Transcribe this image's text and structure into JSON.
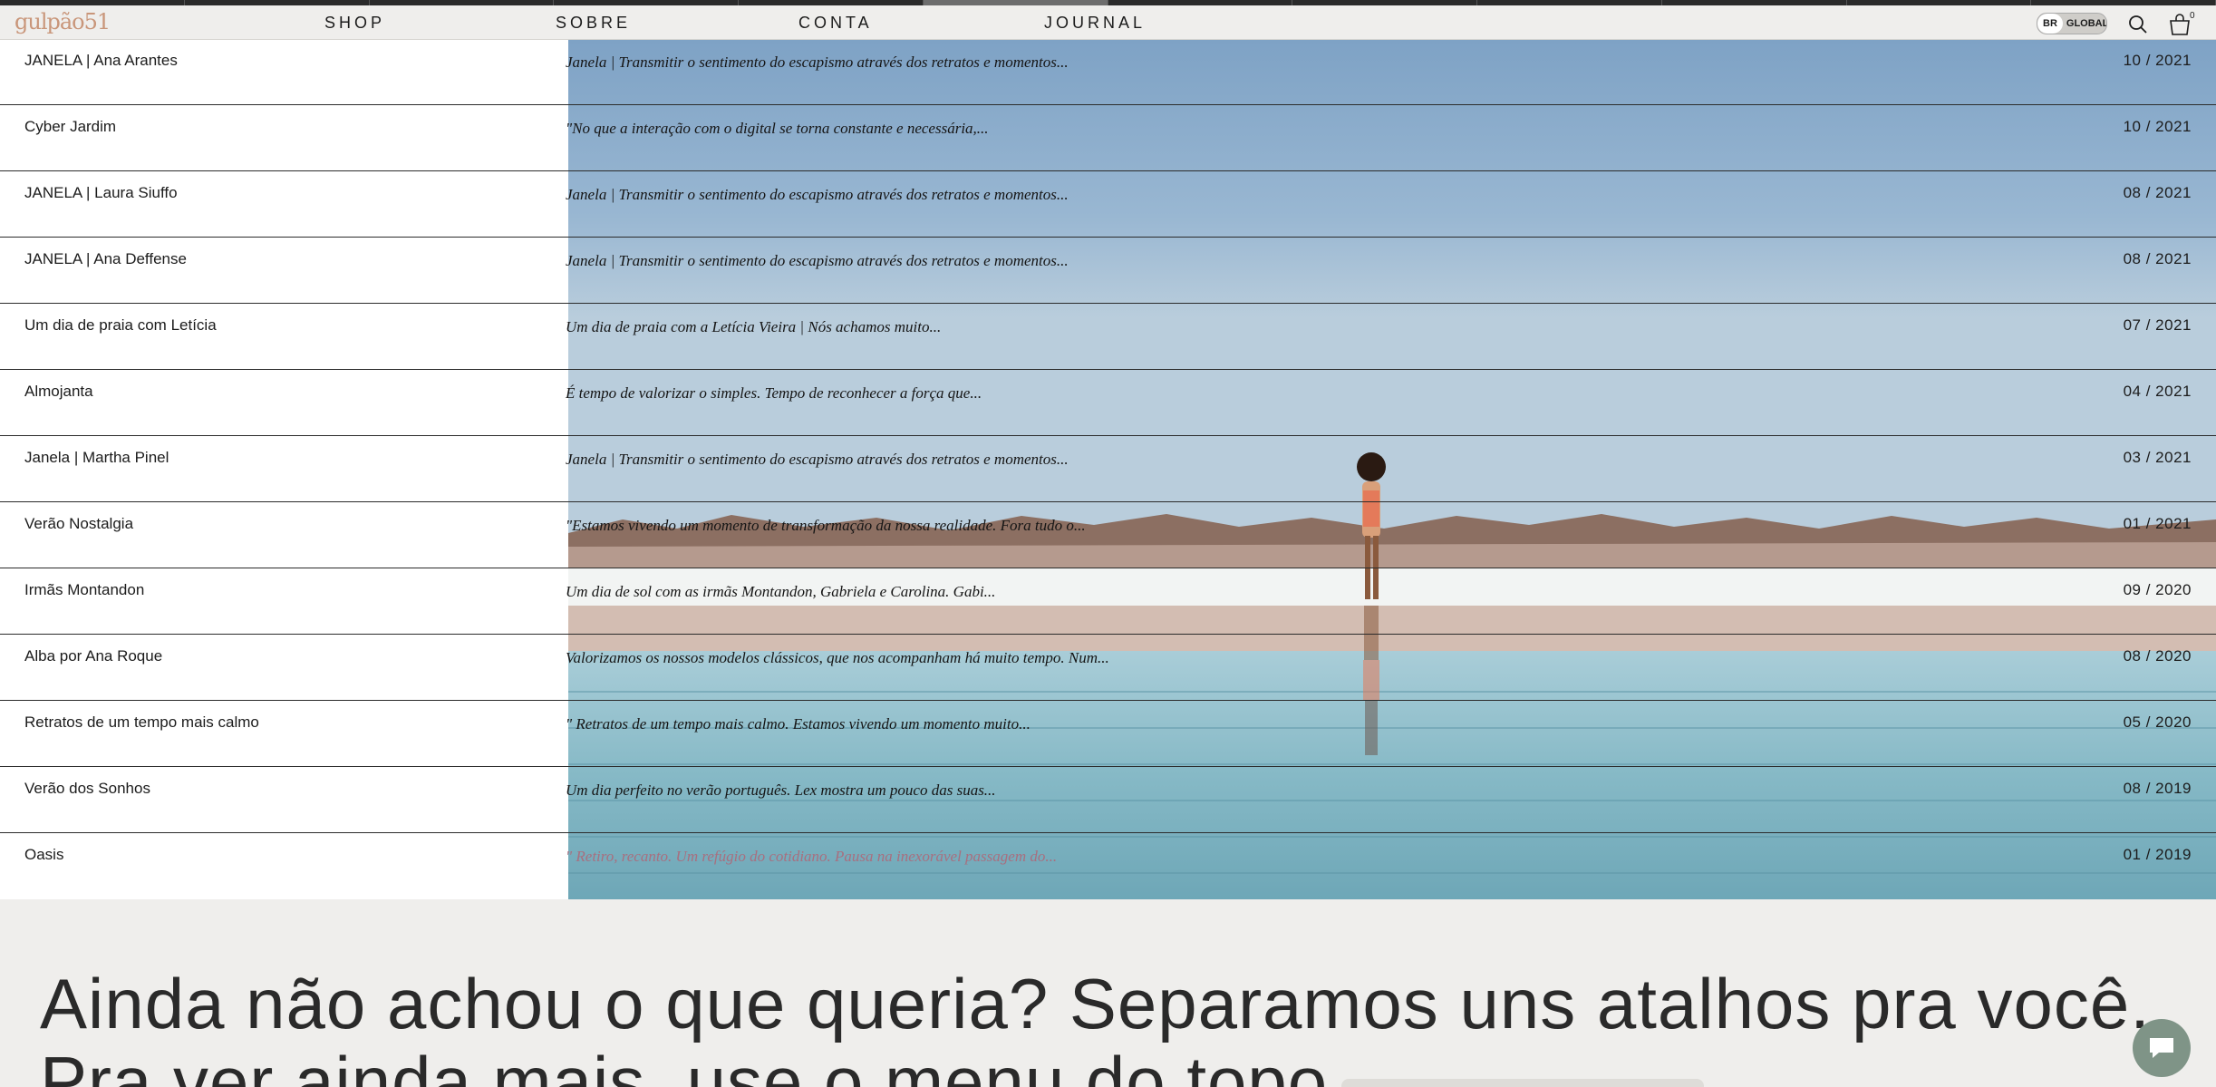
{
  "header": {
    "logo": "gulpão51",
    "nav": [
      "SHOP",
      "SOBRE",
      "CONTA",
      "JOURNAL"
    ],
    "region": {
      "primary": "BR",
      "secondary": "GLOBAL"
    },
    "cart_count": "0"
  },
  "journal": {
    "rows": [
      {
        "title": "JANELA | Ana Arantes",
        "excerpt": "Janela | Transmitir o sentimento do escapismo através dos retratos e momentos...",
        "date": "10 / 2021"
      },
      {
        "title": "Cyber Jardim",
        "excerpt": "\"No que a interação com o digital se torna constante e necessária,...",
        "date": "10 / 2021"
      },
      {
        "title": "JANELA | Laura Siuffo",
        "excerpt": "Janela | Transmitir o sentimento do escapismo através dos retratos e momentos...",
        "date": "08 / 2021"
      },
      {
        "title": "JANELA | Ana Deffense",
        "excerpt": "Janela | Transmitir o sentimento do escapismo através dos retratos e momentos...",
        "date": "08 / 2021"
      },
      {
        "title": "Um dia de praia com Letícia",
        "excerpt": "Um dia de praia com a Letícia Vieira | Nós achamos muito...",
        "date": "07 / 2021"
      },
      {
        "title": "Almojanta",
        "excerpt": "É tempo de valorizar o simples. Tempo de reconhecer a força que...",
        "date": "04 / 2021"
      },
      {
        "title": "Janela | Martha Pinel",
        "excerpt": "Janela | Transmitir o sentimento do escapismo através dos retratos e momentos...",
        "date": "03 / 2021"
      },
      {
        "title": "Verão Nostalgia",
        "excerpt": "\"Estamos vivendo um momento de transformação da nossa realidade. Fora tudo o...",
        "date": "01 / 2021"
      },
      {
        "title": "Irmãs Montandon",
        "excerpt": "Um dia de sol com as irmãs Montandon, Gabriela e Carolina. Gabi...",
        "date": "09 / 2020"
      },
      {
        "title": "Alba por Ana Roque",
        "excerpt": "Valorizamos os nossos modelos clássicos, que nos acompanham há muito tempo. Num...",
        "date": "08 / 2020"
      },
      {
        "title": "Retratos de um tempo mais calmo",
        "excerpt": "\" Retratos de um tempo mais calmo. Estamos vivendo um momento muito...",
        "date": "05 / 2020"
      },
      {
        "title": "Verão dos Sonhos",
        "excerpt": "Um dia perfeito no verão português. Lex mostra um pouco das suas...",
        "date": "08 / 2019"
      },
      {
        "title": "Oasis",
        "excerpt": "\" Retiro, recanto. Um refúgio do cotidiano. Pausa na inexorável passagem do...",
        "date": "01 / 2019"
      }
    ]
  },
  "footer": {
    "headline_line1": "Ainda não achou o que queria? Separamos uns atalhos pra você.",
    "headline_line2": "Pra ver ainda mais, use o menu do topo."
  },
  "colors": {
    "logo": "#c9967a",
    "chat_button": "#7f9487",
    "sky_top": "#7ea2c5",
    "water": "#7fb4c2"
  }
}
